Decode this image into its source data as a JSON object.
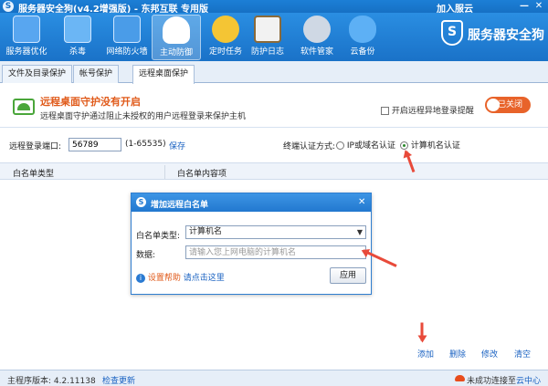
{
  "window": {
    "title": "服务器安全狗(v4.2增强版) - 东邦互联 专用版",
    "join_label": "加入服云",
    "min_label": "—",
    "close_label": "✕"
  },
  "toolbar": {
    "items": [
      {
        "label": "服务器优化",
        "icon": "monitor-optimize-icon",
        "color": "#58a6f0"
      },
      {
        "label": "杀毒",
        "icon": "antivirus-icon",
        "color": "#6bb6f5"
      },
      {
        "label": "网络防火墙",
        "icon": "firewall-icon",
        "color": "#4a9ce8"
      },
      {
        "label": "主动防御",
        "icon": "active-defense-icon",
        "color": "#ffffff"
      },
      {
        "label": "定时任务",
        "icon": "clock-icon",
        "color": "#f4c534"
      },
      {
        "label": "防护日志",
        "icon": "log-clipboard-icon",
        "color": "#f2f2f2"
      },
      {
        "label": "软件管家",
        "icon": "software-disc-icon",
        "color": "#cfd8e4"
      },
      {
        "label": "云备份",
        "icon": "cloud-backup-icon",
        "color": "#5db0f5"
      }
    ],
    "brand": "服务器安全狗"
  },
  "tabs": [
    {
      "label": "文件及目录保护",
      "active": false
    },
    {
      "label": "帐号保护",
      "active": false
    },
    {
      "label": "远程桌面保护",
      "active": true
    }
  ],
  "banner": {
    "title": "远程桌面守护没有开启",
    "desc": "远程桌面守护通过阻止未授权的用户远程登录来保护主机",
    "checkbox_label": "开启远程异地登录提醒",
    "toggle_label": "已关闭"
  },
  "port": {
    "label": "远程登录端口:",
    "value": "56789",
    "range": "(1-65535)",
    "save": "保存",
    "auth_label": "终端认证方式:",
    "option_ip": "IP或域名认证",
    "option_pc": "计算机名认证"
  },
  "table": {
    "headers": [
      "白名单类型",
      "白名单内容项"
    ]
  },
  "dialog": {
    "title": "增加远程白名单",
    "type_label": "白名单类型:",
    "type_value": "计算机名",
    "data_label": "数据:",
    "data_placeholder": "请输入您上网电脑的计算机名",
    "help_label": "设置帮助",
    "help_link": "请点击这里",
    "apply": "应用"
  },
  "actions": {
    "add": "添加",
    "delete": "删除",
    "edit": "修改",
    "clear": "清空"
  },
  "status": {
    "version": "主程序版本: 4.2.11138",
    "check_update": "检查更新",
    "connection": "未成功连接至",
    "cloud_center": "云中心"
  }
}
